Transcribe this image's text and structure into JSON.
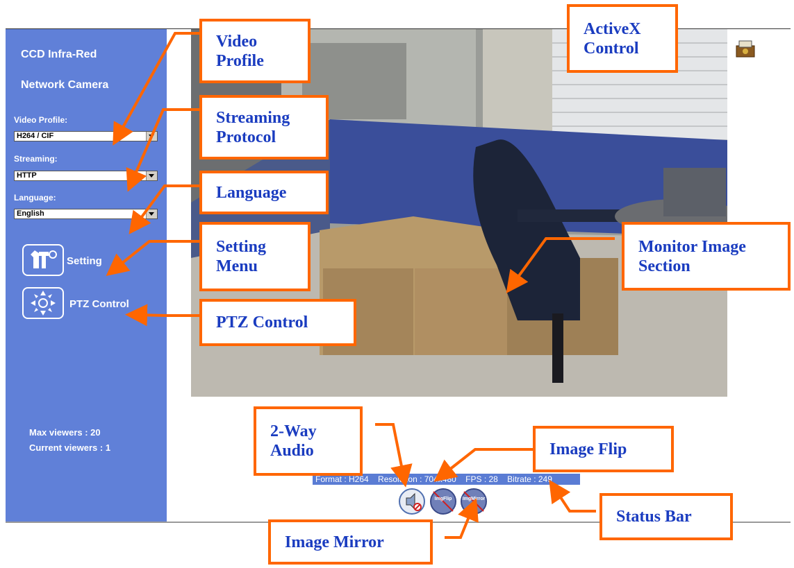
{
  "sidebar": {
    "title_line1": "CCD Infra-Red",
    "title_line2": "Network Camera",
    "video_profile_label": "Video Profile:",
    "video_profile_value": "H264 / CIF",
    "streaming_label": "Streaming:",
    "streaming_value": "HTTP",
    "language_label": "Language:",
    "language_value": "English",
    "setting_label": "Setting",
    "ptz_label": "PTZ Control",
    "max_viewers": "Max viewers : 20",
    "current_viewers": "Current viewers :  1"
  },
  "status_bar": {
    "format": "Format : H264",
    "resolution": "Resolution : 704x480",
    "fps": "FPS : 28",
    "bitrate": "Bitrate : 249"
  },
  "buttons": {
    "img_flip": "ImgFlip",
    "img_mirror": "ImgMirror"
  },
  "callouts": {
    "video_profile": [
      "Video",
      "Profile"
    ],
    "streaming_protocol": [
      "Streaming",
      "Protocol"
    ],
    "language": [
      "Language"
    ],
    "setting_menu": [
      "Setting",
      "Menu"
    ],
    "ptz_control": [
      "PTZ Control"
    ],
    "activex_control": [
      "ActiveX",
      "Control"
    ],
    "monitor_image_section": [
      "Monitor Image",
      "Section"
    ],
    "two_way_audio": [
      "2-Way",
      "Audio"
    ],
    "image_flip": [
      "Image Flip"
    ],
    "status_bar": [
      "Status Bar"
    ],
    "image_mirror": [
      "Image Mirror"
    ]
  },
  "colors": {
    "sidebar_bg": "#6080d8",
    "callout_border": "#ff6600",
    "callout_text": "#1a3cc0",
    "status_bar_bg": "#5a7cd4"
  }
}
